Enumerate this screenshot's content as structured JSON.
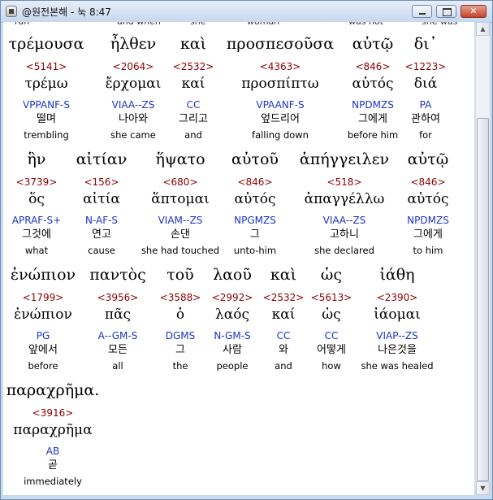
{
  "window": {
    "title": "@원전본해 - 눅 8:47",
    "controls": {
      "minimize": "minimize",
      "maximize": "maximize",
      "close": "✕"
    }
  },
  "clipped_top_text": [
    "ran",
    "and when",
    "she",
    "woman",
    "was not",
    "she was"
  ],
  "rows": [
    {
      "words": [
        {
          "greek": "τρέμουσα",
          "strong": "<5141>",
          "lemma": "τρέμω",
          "parse": "VPPANF-S",
          "korean": "떨며",
          "english": "trembling"
        },
        {
          "greek": "ἦλθεν",
          "strong": "<2064>",
          "lemma": "ἔρχομαι",
          "parse": "VIAA--ZS",
          "korean": "나아와",
          "english": "she came"
        },
        {
          "greek": "καὶ",
          "strong": "<2532>",
          "lemma": "καί",
          "parse": "CC",
          "korean": "그리고",
          "english": "and"
        },
        {
          "greek": "προσπεσοῦσα",
          "strong": "<4363>",
          "lemma": "προσπίπτω",
          "parse": "VPAANF-S",
          "korean": "엎드리어",
          "english": "falling down"
        },
        {
          "greek": "αὐτῷ",
          "strong": "<846>",
          "lemma": "αὐτός",
          "parse": "NPDMZS",
          "korean": "그에게",
          "english": "before him"
        },
        {
          "greek": "δι᾽",
          "strong": "<1223>",
          "lemma": "διά",
          "parse": "PA",
          "korean": "관하여",
          "english": "for"
        }
      ]
    },
    {
      "words": [
        {
          "greek": "ἣν",
          "strong": "<3739>",
          "lemma": "ὅς",
          "parse": "APRAF-S+",
          "korean": "그것에",
          "english": "what"
        },
        {
          "greek": "αἰτίαν",
          "strong": "<156>",
          "lemma": "αἰτία",
          "parse": "N-AF-S",
          "korean": "연고",
          "english": "cause"
        },
        {
          "greek": "ἥψατο",
          "strong": "<680>",
          "lemma": "ἅπτομαι",
          "parse": "VIAM--ZS",
          "korean": "손댄",
          "english": "she had touched"
        },
        {
          "greek": "αὐτοῦ",
          "strong": "<846>",
          "lemma": "αὐτός",
          "parse": "NPGMZS",
          "korean": "그",
          "english": "unto-him"
        },
        {
          "greek": "ἀπήγγειλεν",
          "strong": "<518>",
          "lemma": "ἀπαγγέλλω",
          "parse": "VIAA--ZS",
          "korean": "고하니",
          "english": "she declared"
        },
        {
          "greek": "αὐτῷ",
          "strong": "<846>",
          "lemma": "αὐτός",
          "parse": "NPDMZS",
          "korean": "그에게",
          "english": "to him"
        }
      ]
    },
    {
      "words": [
        {
          "greek": "ἐνώπιον",
          "strong": "<1799>",
          "lemma": "ἐνώπιον",
          "parse": "PG",
          "korean": "앞에서",
          "english": "before"
        },
        {
          "greek": "παντὸς",
          "strong": "<3956>",
          "lemma": "πᾶς",
          "parse": "A--GM-S",
          "korean": "모든",
          "english": "all"
        },
        {
          "greek": "τοῦ",
          "strong": "<3588>",
          "lemma": "ὁ",
          "parse": "DGMS",
          "korean": "그",
          "english": "the"
        },
        {
          "greek": "λαοῦ",
          "strong": "<2992>",
          "lemma": "λαός",
          "parse": "N-GM-S",
          "korean": "사람",
          "english": "people"
        },
        {
          "greek": "καὶ",
          "strong": "<2532>",
          "lemma": "καί",
          "parse": "CC",
          "korean": "와",
          "english": "and"
        },
        {
          "greek": "ὡς",
          "strong": "<5613>",
          "lemma": "ὡς",
          "parse": "CC",
          "korean": "어떻게",
          "english": "how"
        },
        {
          "greek": "ἰάθη",
          "strong": "<2390>",
          "lemma": "ἰάομαι",
          "parse": "VIAP--ZS",
          "korean": "나은것을",
          "english": "she was healed"
        }
      ]
    },
    {
      "words": [
        {
          "greek": "παραχρῆμα.",
          "strong": "<3916>",
          "lemma": "παραχρῆμα",
          "parse": "AB",
          "korean": "곧",
          "english": "immediately"
        }
      ]
    }
  ]
}
